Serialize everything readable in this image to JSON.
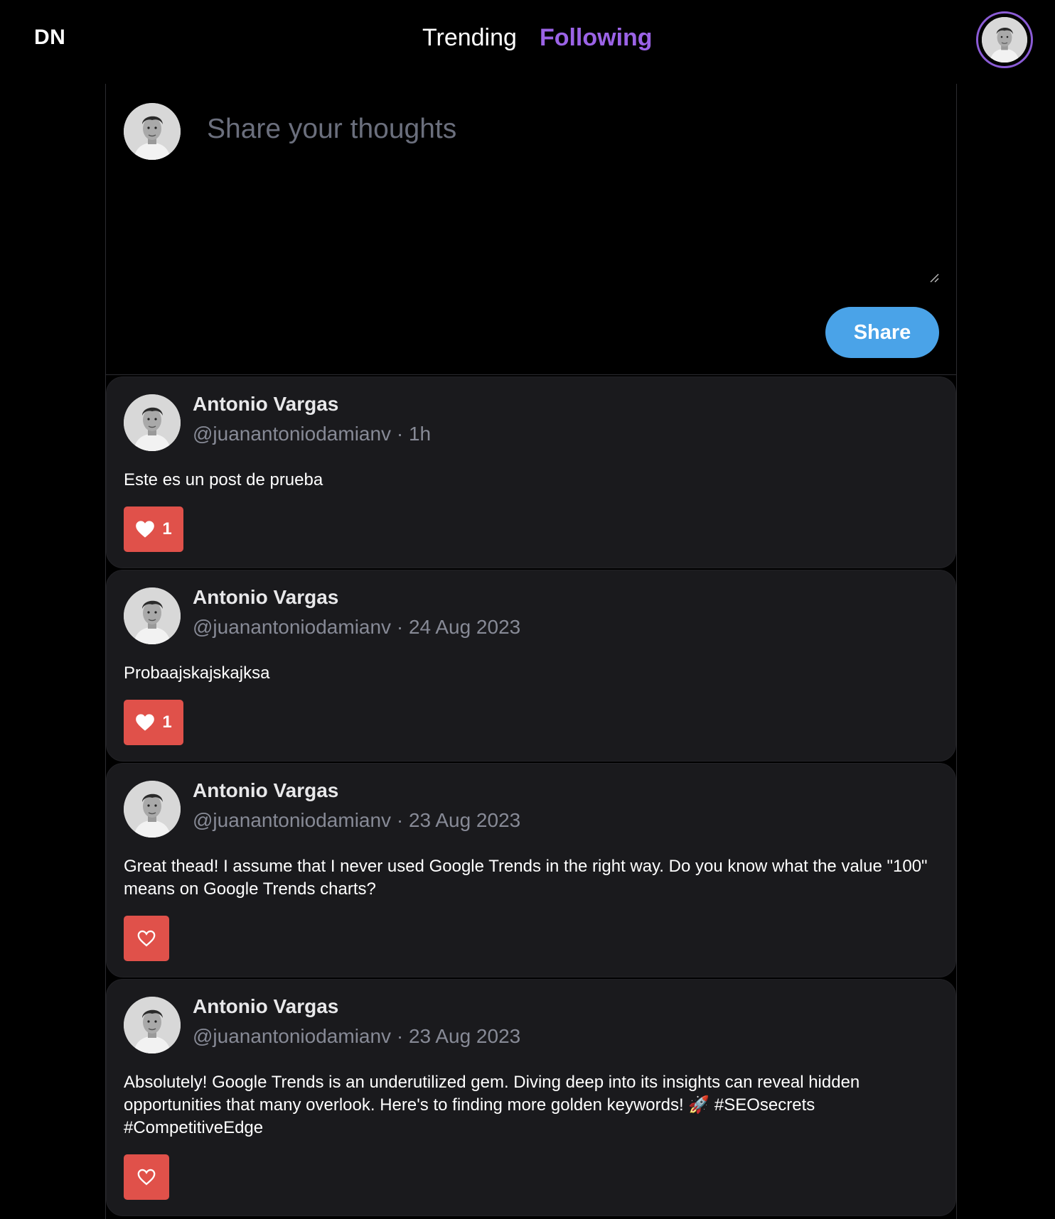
{
  "header": {
    "logo": "DN",
    "tabs": [
      {
        "label": "Trending",
        "active": false
      },
      {
        "label": "Following",
        "active": true
      }
    ],
    "accent_color": "#9b63e6"
  },
  "composer": {
    "placeholder": "Share your thoughts",
    "share_label": "Share",
    "share_color": "#4aa3e8"
  },
  "posts": [
    {
      "name": "Antonio Vargas",
      "handle": "@juanantoniodamianv",
      "time": "1h",
      "meta": "@juanantoniodamianv · 1h",
      "text": "Este es un post de prueba",
      "liked": true,
      "likes": "1"
    },
    {
      "name": "Antonio Vargas",
      "handle": "@juanantoniodamianv",
      "time": "24 Aug 2023",
      "meta": "@juanantoniodamianv · 24 Aug 2023",
      "text": "Probaajskajskajksa",
      "liked": true,
      "likes": "1"
    },
    {
      "name": "Antonio Vargas",
      "handle": "@juanantoniodamianv",
      "time": "23 Aug 2023",
      "meta": "@juanantoniodamianv · 23 Aug 2023",
      "text": "Great thead! I assume that I never used Google Trends in the right way. Do you know what the value \"100\" means on Google Trends charts?",
      "liked": false,
      "likes": ""
    },
    {
      "name": "Antonio Vargas",
      "handle": "@juanantoniodamianv",
      "time": "23 Aug 2023",
      "meta": "@juanantoniodamianv · 23 Aug 2023",
      "text": "Absolutely! Google Trends is an underutilized gem. Diving deep into its insights can reveal hidden opportunities that many overlook. Here's to finding more golden keywords! 🚀 #SEOsecrets #CompetitiveEdge",
      "liked": false,
      "likes": ""
    }
  ],
  "like_color": "#e0514a",
  "icons": {
    "avatar": "user-avatar-photo",
    "like_filled": "heart-filled-icon",
    "like_outline": "heart-outline-icon",
    "resize": "resize-grip-icon"
  }
}
